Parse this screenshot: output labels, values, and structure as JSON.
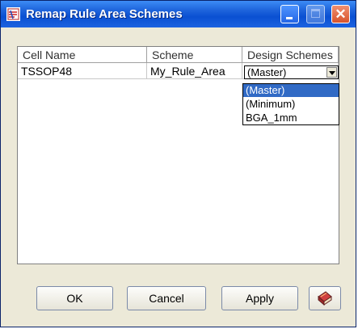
{
  "window": {
    "title": "Remap Rule Area Schemes"
  },
  "grid": {
    "headers": [
      "Cell Name",
      "Scheme",
      "Design Schemes"
    ],
    "rows": [
      {
        "cell_name": "TSSOP48",
        "scheme": "My_Rule_Area",
        "design_scheme": "(Master)"
      }
    ]
  },
  "dropdown": {
    "options": [
      "(Master)",
      "(Minimum)",
      "BGA_1mm"
    ],
    "selected_index": 0
  },
  "buttons": {
    "ok": "OK",
    "cancel": "Cancel",
    "apply": "Apply",
    "help_icon": "book-icon"
  },
  "colors": {
    "titlebar": "#0a50d2",
    "selection": "#316ac5",
    "dialog_bg": "#ece9d8"
  }
}
